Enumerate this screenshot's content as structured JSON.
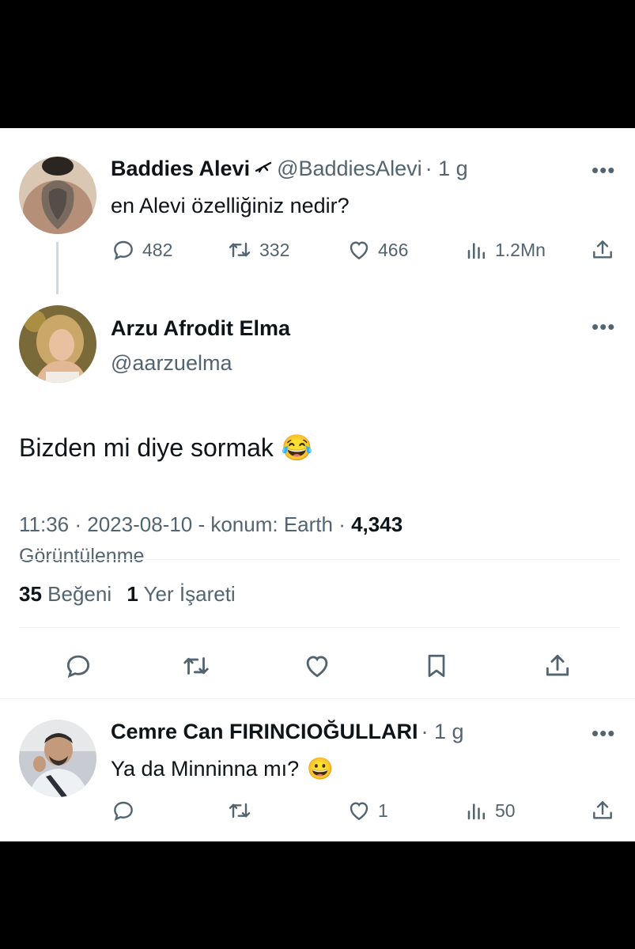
{
  "tweet1": {
    "display_name": "Baddies Alevi",
    "handle": "@BaddiesAlevi",
    "time": "· 1 g",
    "text": "en Alevi özelliğiniz nedir?",
    "replies": "482",
    "retweets": "332",
    "likes": "466",
    "views": "1.2Mn"
  },
  "tweet2": {
    "display_name": "Arzu Afrodit Elma",
    "handle": "@aarzuelma",
    "text": "Bizden mi diye sormak",
    "emoji": "😂",
    "meta_time": "11:36 · 2023-08-10 - konum: Earth ·",
    "meta_views": "4,343",
    "meta_views_label": "Görüntülenme",
    "likes_count": "35",
    "likes_label": "Beğeni",
    "bookmarks_count": "1",
    "bookmarks_label": "Yer İşareti"
  },
  "tweet3": {
    "display_name": "Cemre Can FIRINCIOĞULLARI",
    "time": "· 1 g",
    "text": "Ya da Minninna mı?",
    "emoji": "😀",
    "likes": "1",
    "views": "50"
  },
  "colors": {
    "muted": "#536471",
    "divider": "#eff3f4",
    "text": "#0f1419"
  }
}
